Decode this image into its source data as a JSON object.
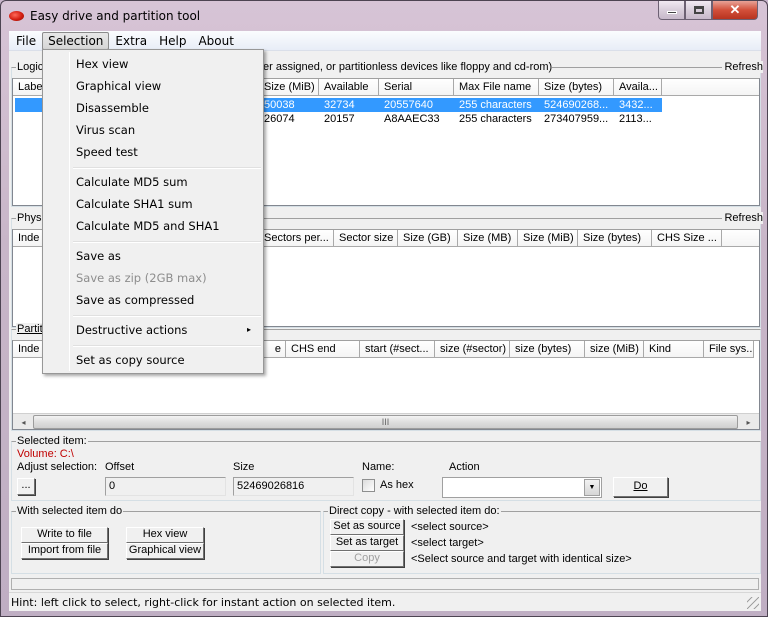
{
  "window": {
    "title": "Easy drive and partition tool",
    "controls": {
      "minimize": "minimize",
      "maximize": "maximize",
      "close": "✕"
    }
  },
  "menubar": {
    "items": [
      "File",
      "Selection",
      "Extra",
      "Help",
      "About"
    ],
    "active": "Selection"
  },
  "selection_menu": {
    "items": [
      {
        "label": "Hex view",
        "enabled": true
      },
      {
        "label": "Graphical view",
        "enabled": true
      },
      {
        "label": "Disassemble",
        "enabled": true
      },
      {
        "label": "Virus scan",
        "enabled": true
      },
      {
        "label": "Speed test",
        "enabled": true
      },
      {
        "label": "Calculate MD5 sum",
        "enabled": true
      },
      {
        "label": "Calculate SHA1 sum",
        "enabled": true
      },
      {
        "label": "Calculate MD5 and SHA1",
        "enabled": true
      },
      {
        "label": "Save as",
        "enabled": true
      },
      {
        "label": "Save as zip (2GB max)",
        "enabled": false
      },
      {
        "label": "Save as compressed",
        "enabled": true
      },
      {
        "label": "Destructive actions",
        "enabled": true,
        "submenu": "▸"
      },
      {
        "label": "Set as copy source",
        "enabled": true
      }
    ]
  },
  "logical": {
    "label_left": "Logic",
    "label_right": "er assigned, or partitionless devices like floppy and cd-rom)",
    "refresh": "Refresh",
    "columns": [
      "Labe",
      "Size (MiB)",
      "Available",
      "Serial",
      "Max File name",
      "Size (bytes)",
      "Availa..."
    ],
    "rows": [
      {
        "selected": true,
        "cells": [
          "",
          "50038",
          "32734",
          "20557640",
          "255 characters",
          "524690268...",
          "3432..."
        ]
      },
      {
        "selected": false,
        "cells": [
          "",
          "26074",
          "20157",
          "A8AAEC33",
          "255 characters",
          "273407959...",
          "2113..."
        ]
      }
    ]
  },
  "physical": {
    "label": "Phys",
    "refresh": "Refresh",
    "columns": [
      "Inde",
      "Sectors per...",
      "Sector size",
      "Size (GB)",
      "Size (MB)",
      "Size (MiB)",
      "Size (bytes)",
      "CHS Size ..."
    ]
  },
  "partitions": {
    "label": "Partit",
    "columns": [
      "Inde",
      "e",
      "CHS end",
      "start (#sect...",
      "size (#sector)",
      "size (bytes)",
      "size (MiB)",
      "Kind",
      "File sys..."
    ],
    "scroll": {
      "left": "◂",
      "right": "▸",
      "thumb": "III"
    }
  },
  "selected_item": {
    "label": "Selected item:",
    "value": "Volume: C:\\",
    "value_color": "#c00000",
    "adjust_label": "Adjust selection:",
    "adjust_button": "...",
    "offset_label": "Offset",
    "offset_value": "0",
    "size_label": "Size",
    "size_value": "52469026816",
    "name_label": "Name:",
    "as_hex_label": "As hex",
    "as_hex_checked": false,
    "action_label": "Action",
    "action_value": "",
    "do_button": "Do"
  },
  "with_selected": {
    "label": "With selected item do",
    "buttons": [
      "Write to file",
      "Import from file",
      "Hex view",
      "Graphical view"
    ]
  },
  "direct_copy": {
    "label": "Direct copy - with selected item do:",
    "set_source": "Set as source",
    "set_target": "Set as target",
    "copy": "Copy",
    "source_status": "<select source>",
    "target_status": "<select target>",
    "copy_status": "<Select source and target with identical size>"
  },
  "status": {
    "hint": "Hint: left click to select, right-click for instant action on selected item."
  }
}
